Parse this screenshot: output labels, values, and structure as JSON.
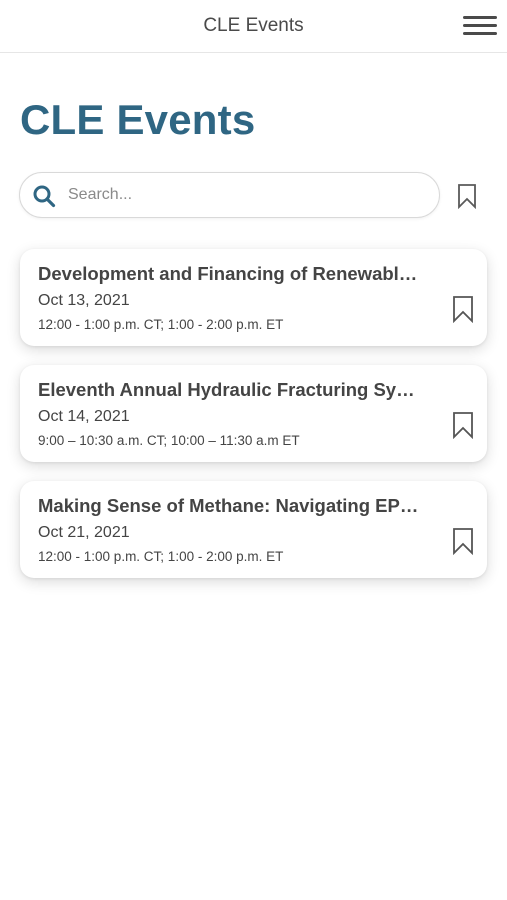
{
  "header": {
    "title": "CLE Events",
    "menu_icon": "hamburger-menu-icon"
  },
  "page": {
    "title": "CLE Events"
  },
  "search": {
    "placeholder": "Search...",
    "value": "",
    "icon": "search-icon"
  },
  "events": [
    {
      "title": "Development and Financing of Renewable Energy Projects",
      "title_display": "Development and Financing of Renewabl…",
      "date": "Oct 13, 2021",
      "time": "12:00 - 1:00 p.m. CT; 1:00 - 2:00 p.m. ET"
    },
    {
      "title": "Eleventh Annual Hydraulic Fracturing Symposium",
      "title_display": "Eleventh Annual Hydraulic Fracturing Sy…",
      "date": "Oct 14, 2021",
      "time": "9:00 – 10:30 a.m. CT; 10:00 – 11:30 a.m ET"
    },
    {
      "title": "Making Sense of Methane: Navigating EPA",
      "title_display": "Making Sense of Methane: Navigating EP…",
      "date": "Oct 21, 2021",
      "time": "12:00 - 1:00 p.m. CT; 1:00 - 2:00 p.m. ET"
    }
  ],
  "colors": {
    "accent": "#2f6683",
    "text": "#444444",
    "icon": "#555555"
  }
}
